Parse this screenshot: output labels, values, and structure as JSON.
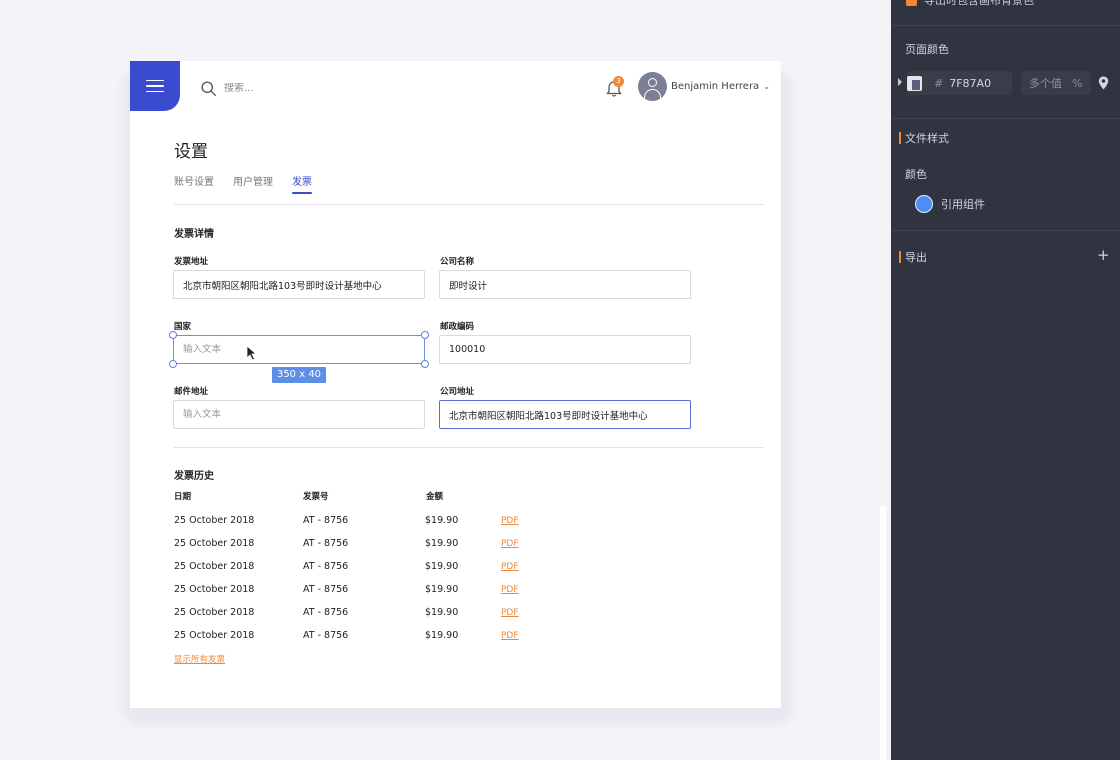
{
  "header": {
    "search_placeholder": "搜索...",
    "notification_count": "3",
    "user_name": "Benjamin Herrera"
  },
  "page": {
    "title": "设置",
    "tabs": [
      {
        "label": "账号设置",
        "active": false
      },
      {
        "label": "用户管理",
        "active": false
      },
      {
        "label": "发票",
        "active": true
      }
    ]
  },
  "invoice_details": {
    "section_title": "发票详情",
    "fields": {
      "invoice_address": {
        "label": "发票地址",
        "value": "北京市朝阳区朝阳北路103号即时设计基地中心"
      },
      "company_name": {
        "label": "公司名称",
        "value": "即时设计"
      },
      "country": {
        "label": "国家",
        "placeholder": "输入文本"
      },
      "postal_code": {
        "label": "邮政编码",
        "value": "100010"
      },
      "email_address": {
        "label": "邮件地址",
        "placeholder": "输入文本"
      },
      "company_address": {
        "label": "公司地址",
        "value": "北京市朝阳区朝阳北路103号即时设计基地中心"
      }
    },
    "selection_size": "350 x 40"
  },
  "invoice_history": {
    "section_title": "发票历史",
    "columns": [
      "日期",
      "发票号",
      "金额"
    ],
    "rows": [
      {
        "date": "25 October 2018",
        "number": "AT - 8756",
        "amount": "$19.90",
        "link": "PDF"
      },
      {
        "date": "25 October 2018",
        "number": "AT - 8756",
        "amount": "$19.90",
        "link": "PDF"
      },
      {
        "date": "25 October 2018",
        "number": "AT - 8756",
        "amount": "$19.90",
        "link": "PDF"
      },
      {
        "date": "25 October 2018",
        "number": "AT - 8756",
        "amount": "$19.90",
        "link": "PDF"
      },
      {
        "date": "25 October 2018",
        "number": "AT - 8756",
        "amount": "$19.90",
        "link": "PDF"
      },
      {
        "date": "25 October 2018",
        "number": "AT - 8756",
        "amount": "$19.90",
        "link": "PDF"
      }
    ],
    "show_all_label": "显示所有发票"
  },
  "design_panel": {
    "top_cut_label": "导出时包含画布背景色",
    "page_color_label": "页面颜色",
    "page_color_hash": "#",
    "page_color_hex": "7F87A0",
    "opacity_value": "多个值",
    "opacity_unit": "%",
    "doc_style_label": "文件样式",
    "color_label": "颜色",
    "ref_component_label": "引用组件",
    "export_label": "导出",
    "add_symbol": "+"
  },
  "colors": {
    "accent": "#3b4bcf",
    "link_orange": "#f0883a",
    "panel_bg": "#303340",
    "selection_blue": "#5d8fe8"
  }
}
